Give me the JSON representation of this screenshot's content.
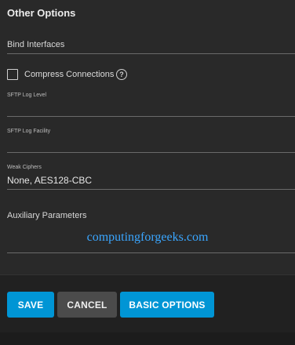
{
  "section": {
    "title": "Other Options"
  },
  "fields": {
    "bind_interfaces": {
      "label": "Bind Interfaces"
    },
    "compress": {
      "label": "Compress Connections",
      "checked": false,
      "help_icon": "help-circle-icon",
      "help_glyph": "?"
    },
    "sftp_log_level": {
      "label": "SFTP Log Level",
      "value": ""
    },
    "sftp_log_facility": {
      "label": "SFTP Log Facility",
      "value": ""
    },
    "weak_ciphers": {
      "label": "Weak Ciphers",
      "value": "None, AES128-CBC"
    },
    "auxiliary": {
      "label": "Auxiliary Parameters",
      "value": ""
    }
  },
  "watermark": "computingforgeeks.com",
  "actions": {
    "save": "SAVE",
    "cancel": "CANCEL",
    "basic_options": "BASIC OPTIONS"
  },
  "colors": {
    "accent": "#0095d5",
    "secondary_button": "#4b4b4b",
    "background": "#292929",
    "watermark": "#3aa6ff"
  }
}
